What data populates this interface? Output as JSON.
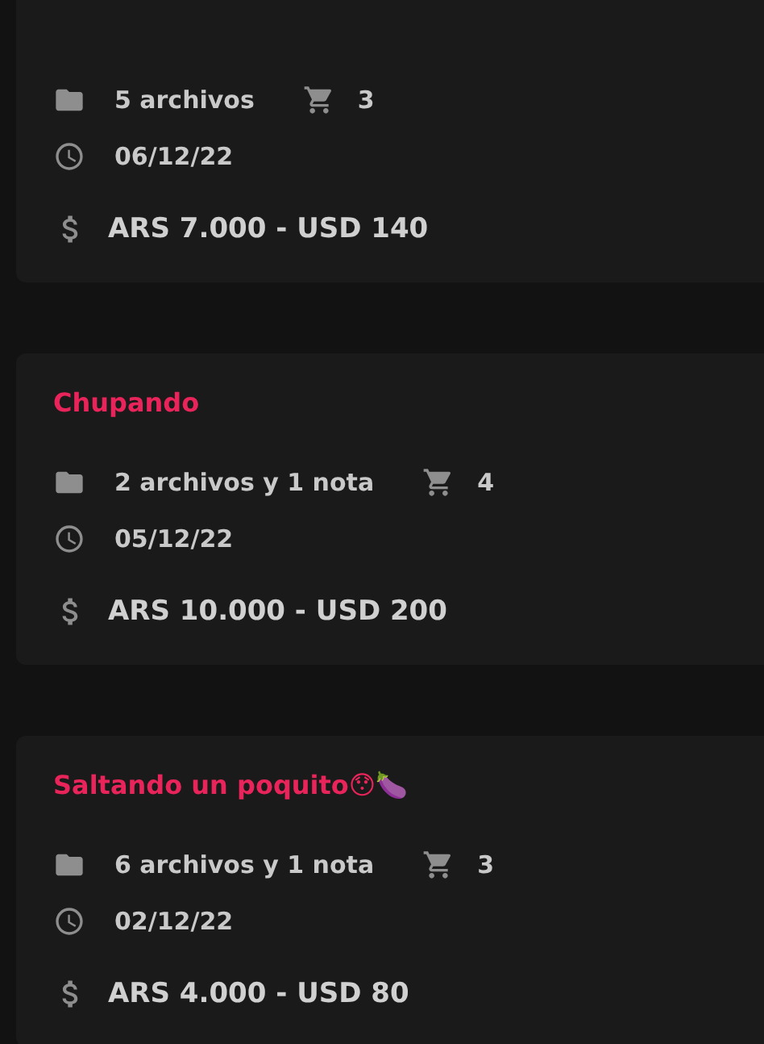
{
  "posts": [
    {
      "files": "5 archivos",
      "cart_count": "3",
      "date": "06/12/22",
      "price": "ARS 7.000 - USD 140"
    },
    {
      "title": "Chupando",
      "files": "2 archivos y 1 nota",
      "cart_count": "4",
      "date": "05/12/22",
      "price": "ARS 10.000 - USD 200"
    },
    {
      "title": "Saltando un poquito😯🍆",
      "files": "6 archivos y 1 nota",
      "cart_count": "3",
      "date": "02/12/22",
      "price": "ARS 4.000 - USD 80"
    }
  ]
}
